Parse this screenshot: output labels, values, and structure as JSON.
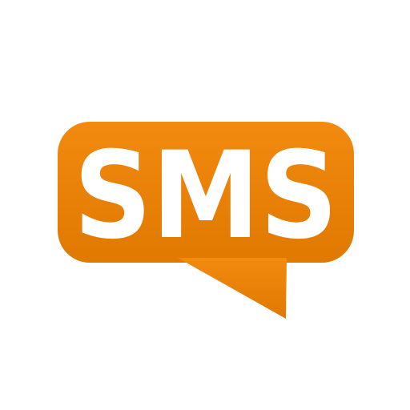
{
  "icon": {
    "name": "sms-speech-bubble-icon",
    "text": "SMS",
    "colors": {
      "bubble_top": "#f28a10",
      "bubble_bottom": "#e07900",
      "text": "#ffffff",
      "background": "#ffffff"
    }
  }
}
